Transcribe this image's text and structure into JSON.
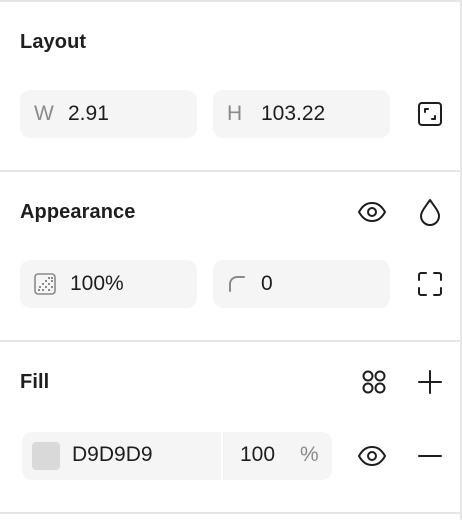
{
  "layout": {
    "title": "Layout",
    "width": {
      "prefix": "W",
      "value": "2.91"
    },
    "height": {
      "prefix": "H",
      "value": "103.22"
    },
    "resize_icon": "resize-to-fit-icon"
  },
  "appearance": {
    "title": "Appearance",
    "visibility_icon": "eye-icon",
    "blend_icon": "drop-icon",
    "opacity": {
      "icon": "opacity-icon",
      "value": "100%"
    },
    "corner_radius": {
      "icon": "corner-radius-icon",
      "value": "0"
    },
    "independent_corners_icon": "independent-corners-icon"
  },
  "fill": {
    "title": "Fill",
    "styles_icon": "styles-grid-icon",
    "add_icon": "plus-icon",
    "items": [
      {
        "color": "#D9D9D9",
        "hex": "D9D9D9",
        "opacity": "100",
        "opacity_unit": "%",
        "visibility_icon": "eye-icon",
        "remove_icon": "minus-icon"
      }
    ]
  }
}
